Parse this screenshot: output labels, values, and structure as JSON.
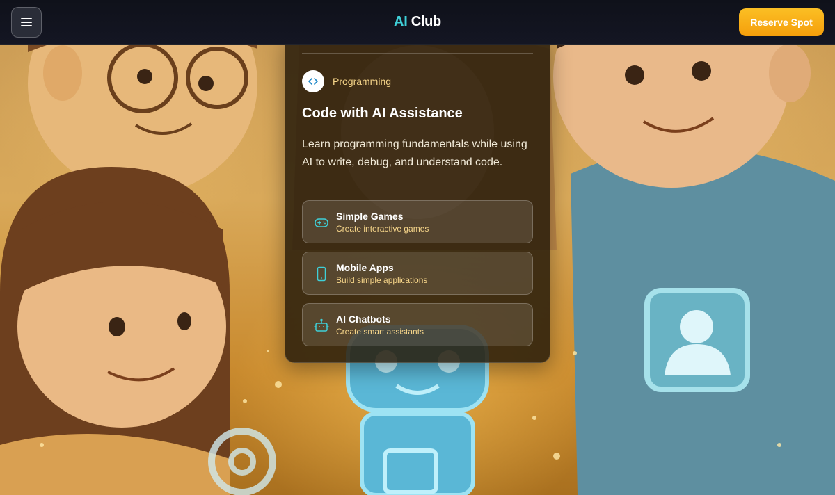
{
  "header": {
    "brand_ai": "AI",
    "brand_rest": " Club",
    "reserve_label": "Reserve Spot"
  },
  "card": {
    "category": "Programming",
    "title": "Code with AI Assistance",
    "description": "Learn programming fundamentals while using AI to write, debug, and understand code.",
    "features": [
      {
        "title": "Simple Games",
        "subtitle": "Create interactive games",
        "icon": "gamepad-icon"
      },
      {
        "title": "Mobile Apps",
        "subtitle": "Build simple applications",
        "icon": "smartphone-icon"
      },
      {
        "title": "AI Chatbots",
        "subtitle": "Create smart assistants",
        "icon": "bot-icon"
      }
    ]
  },
  "colors": {
    "accent_cyan": "#3fd0d8",
    "accent_amber": "#f59e0b",
    "subtitle_gold": "#f7d68a",
    "header_bg": "#11131c"
  }
}
